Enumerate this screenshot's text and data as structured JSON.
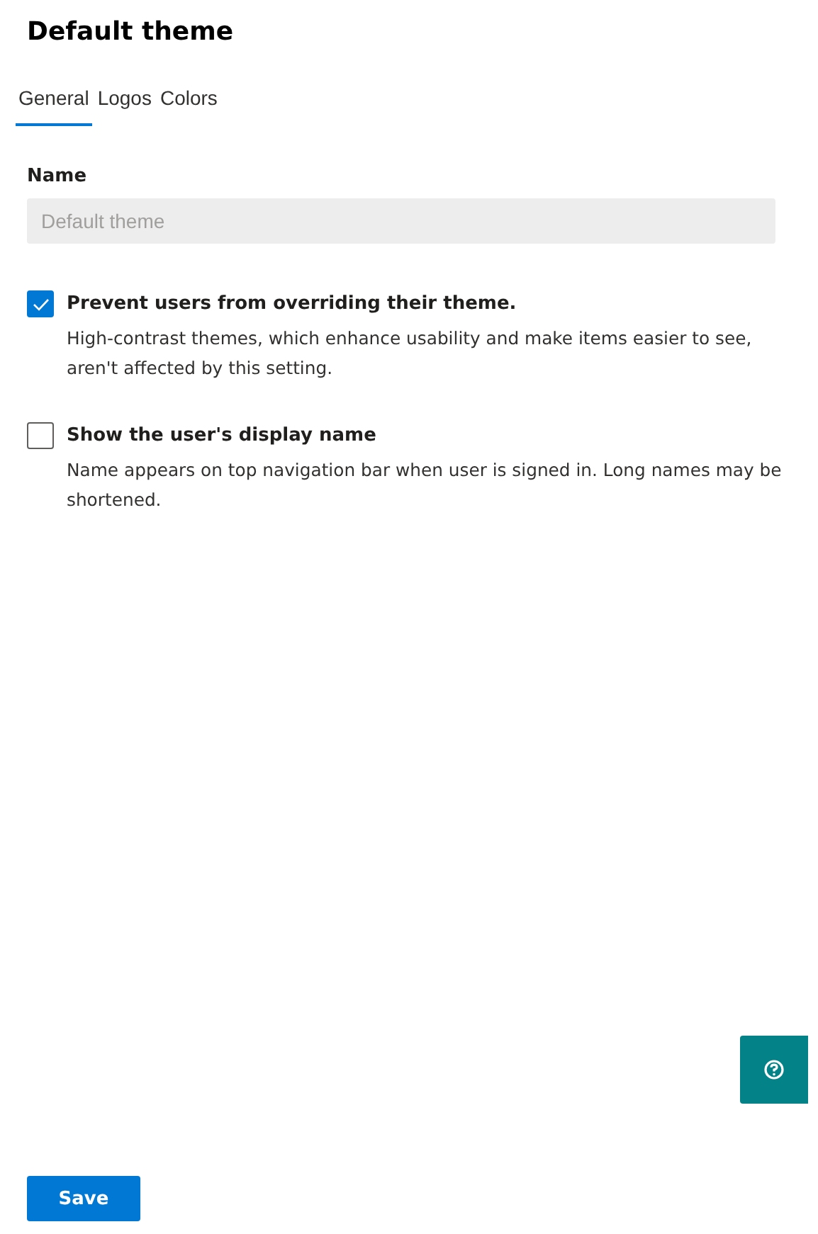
{
  "title": "Default theme",
  "tabs": [
    {
      "label": "General",
      "selected": true
    },
    {
      "label": "Logos",
      "selected": false
    },
    {
      "label": "Colors",
      "selected": false
    }
  ],
  "name_field": {
    "label": "Name",
    "value": "Default theme",
    "disabled": true
  },
  "options": [
    {
      "label": "Prevent users from overriding their theme.",
      "description": "High-contrast themes, which enhance usability and make items easier to see, aren't affected by this setting.",
      "checked": true
    },
    {
      "label": "Show the user's display name",
      "description": "Name appears on top navigation bar when user is signed in. Long names may be shortened.",
      "checked": false
    }
  ],
  "save_button": "Save"
}
